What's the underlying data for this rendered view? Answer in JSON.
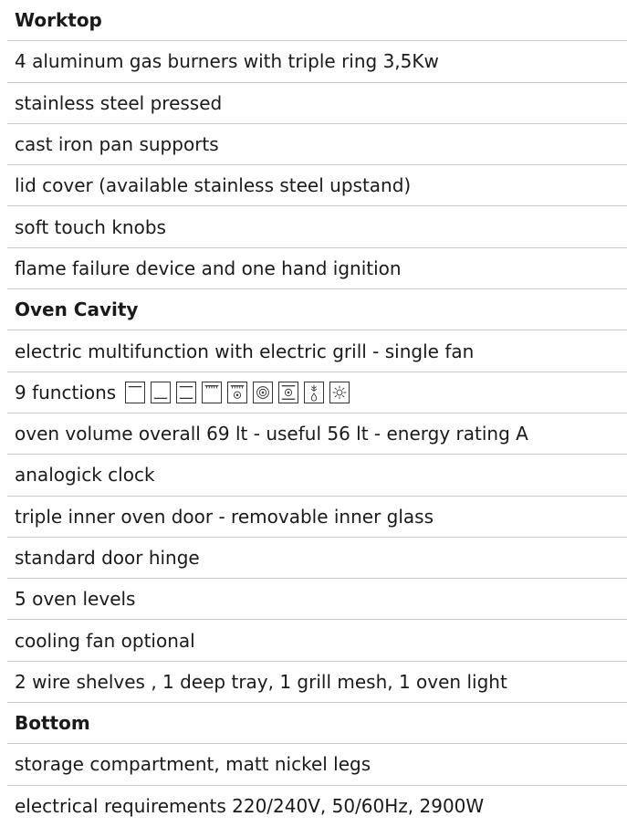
{
  "sections": [
    {
      "title": "Worktop",
      "items": [
        "4 aluminum gas burners with triple ring 3,5Kw",
        "stainless steel pressed",
        "cast iron pan supports",
        "lid cover (available stainless steel upstand)",
        "soft touch knobs",
        "flame failure device and one hand ignition"
      ]
    },
    {
      "title": "Oven Cavity",
      "items_before": [
        "electric multifunction with electric grill - single fan"
      ],
      "functions_label": "9 functions",
      "function_icons": [
        "top-heat-icon",
        "bottom-heat-icon",
        "top-bottom-heat-icon",
        "grill-icon",
        "grill-fan-icon",
        "fan-circular-icon",
        "fan-top-bottom-icon",
        "defrost-icon",
        "oven-light-icon"
      ],
      "items_after": [
        "oven volume overall  69 lt - useful 56 lt - energy rating A",
        "analogick clock",
        "triple inner oven door - removable inner glass",
        "standard door hinge",
        "5 oven levels",
        "cooling fan optional",
        "2 wire shelves , 1 deep tray, 1 grill mesh, 1 oven light"
      ]
    },
    {
      "title": "Bottom",
      "items": [
        "storage compartment, matt nickel legs",
        "electrical requirements 220/240V, 50/60Hz, 2900W"
      ]
    }
  ]
}
